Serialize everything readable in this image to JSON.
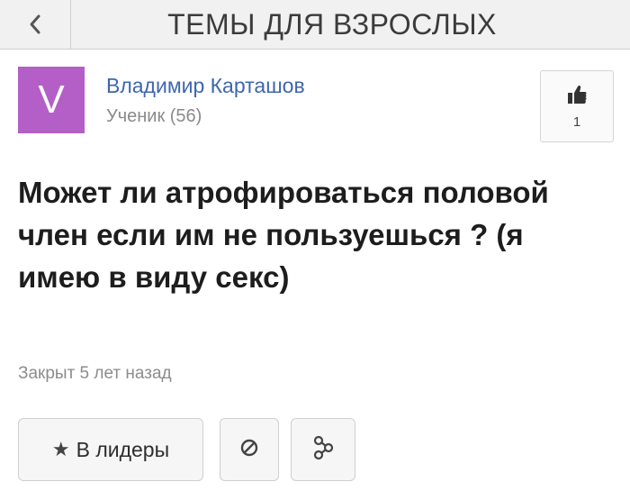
{
  "header": {
    "back_icon": "chevron-left-icon",
    "title": "ТЕМЫ ДЛЯ ВЗРОСЛЫХ"
  },
  "author": {
    "avatar_letter": "V",
    "avatar_color": "#b35fc7",
    "name": "Владимир Карташов",
    "rank": "Ученик (56)"
  },
  "like": {
    "icon": "thumbs-up-icon",
    "count": "1"
  },
  "question": {
    "text": "Может ли атрофироваться половой член если им не пользуешься ? (я имею в виду секс)"
  },
  "status": {
    "closed_text": "Закрыт 5 лет назад"
  },
  "actions": {
    "leaders_label": "В лидеры",
    "leaders_icon": "star-icon",
    "block_icon": "block-icon",
    "share_icon": "share-icon"
  },
  "colors": {
    "link": "#3f66ae",
    "muted": "#8a8a8a"
  }
}
